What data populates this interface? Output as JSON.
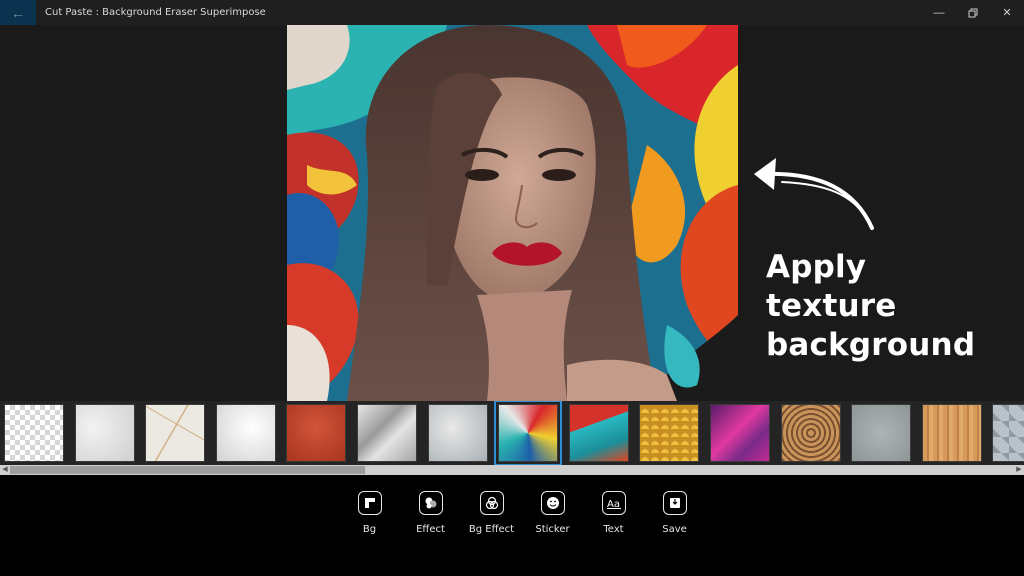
{
  "window": {
    "title": "Cut Paste : Background Eraser Superimpose",
    "back_icon": "arrow-left-icon",
    "controls": [
      "minimize",
      "restore",
      "close"
    ]
  },
  "annotation": {
    "line1": "Apply texture",
    "line2": "background"
  },
  "textures": [
    {
      "name": "transparent",
      "selected": false
    },
    {
      "name": "white-plaster",
      "selected": false
    },
    {
      "name": "cracked-marble",
      "selected": false
    },
    {
      "name": "white-stucco",
      "selected": false
    },
    {
      "name": "red-leather",
      "selected": false
    },
    {
      "name": "crumpled-paper",
      "selected": false
    },
    {
      "name": "silver-texture",
      "selected": false
    },
    {
      "name": "fluid-paint",
      "selected": true
    },
    {
      "name": "red-teal-paint",
      "selected": false
    },
    {
      "name": "gold-scales",
      "selected": false
    },
    {
      "name": "pink-silk",
      "selected": false
    },
    {
      "name": "tree-rings",
      "selected": false
    },
    {
      "name": "grey-stone",
      "selected": false
    },
    {
      "name": "light-wood",
      "selected": false
    },
    {
      "name": "diamond-tiles",
      "selected": false
    }
  ],
  "toolbar": {
    "items": [
      {
        "label": "Bg",
        "icon": "bg-icon"
      },
      {
        "label": "Effect",
        "icon": "effect-icon"
      },
      {
        "label": "Bg Effect",
        "icon": "bg-effect-icon"
      },
      {
        "label": "Sticker",
        "icon": "sticker-icon"
      },
      {
        "label": "Text",
        "icon": "text-icon"
      },
      {
        "label": "Save",
        "icon": "save-icon"
      }
    ]
  },
  "colors": {
    "accent": "#2d8fd6",
    "toolbar_bg": "#000000",
    "workspace_bg": "#1a1a1a"
  }
}
